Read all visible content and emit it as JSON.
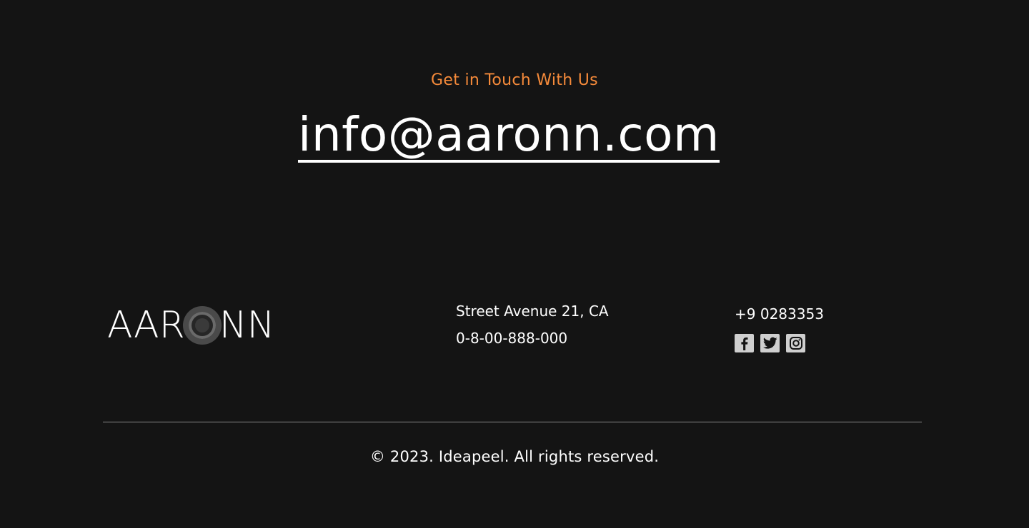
{
  "contact": {
    "eyebrow": "Get in Touch With Us",
    "email": "info@aaronn.com",
    "accent_color": "#F58A3A"
  },
  "footer": {
    "logo": {
      "before_o": "AAR",
      "after_o": "NN",
      "alt": "AARONN"
    },
    "address": "Street Avenue 21, CA",
    "phone_alt": "0-8-00-888-000",
    "phone": "+9 0283353",
    "socials": [
      {
        "name": "facebook-icon"
      },
      {
        "name": "twitter-icon"
      },
      {
        "name": "instagram-icon"
      }
    ],
    "copyright": "© 2023. Ideapeel. All rights reserved."
  },
  "colors": {
    "background": "#141414",
    "text": "#FFFFFF",
    "icon_bg": "#CFCFCF"
  }
}
